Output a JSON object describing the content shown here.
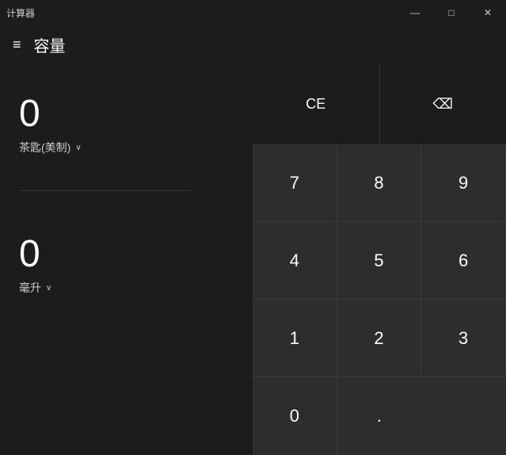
{
  "titlebar": {
    "title": "计算器",
    "minimize": "—",
    "maximize": "□",
    "close": "✕"
  },
  "header": {
    "hamburger": "≡",
    "title": "容量"
  },
  "input": {
    "value": "0",
    "unit": "茶匙(美制)",
    "chevron": "∨"
  },
  "output": {
    "value": "0",
    "unit": "毫升",
    "chevron": "∨"
  },
  "keypad": {
    "ce_label": "CE",
    "buttons": [
      "7",
      "8",
      "9",
      "4",
      "5",
      "6",
      "1",
      "2",
      "3",
      "0",
      "."
    ]
  }
}
